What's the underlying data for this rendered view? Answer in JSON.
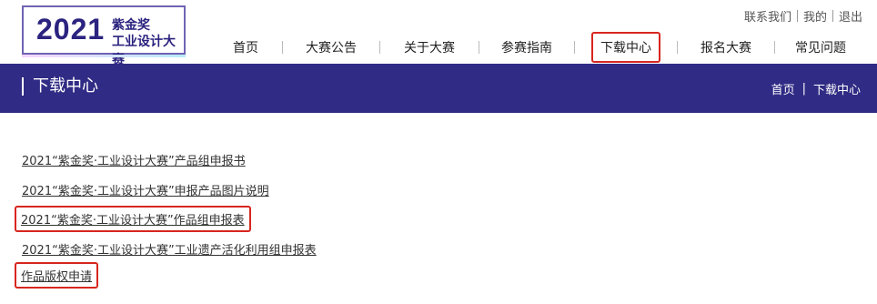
{
  "logo": {
    "year": "2021",
    "line1": "紫金奖",
    "line2": "工业设计大赛"
  },
  "util": {
    "contact": "联系我们",
    "mine": "我的",
    "logout": "退出"
  },
  "nav": {
    "items": [
      "首页",
      "大赛公告",
      "关于大赛",
      "参赛指南",
      "下载中心",
      "报名大赛",
      "常见问题"
    ],
    "active_index": 4,
    "highlight_color": "#d7261f"
  },
  "banner": {
    "title": "下载中心",
    "breadcrumb": [
      "首页",
      "|",
      "下载中心"
    ],
    "background": "#302b84"
  },
  "downloads": [
    "2021“紫金奖·工业设计大赛”产品组申报书",
    "2021“紫金奖·工业设计大赛”申报产品图片说明",
    "2021“紫金奖·工业设计大赛”作品组申报表",
    "2021“紫金奖·工业设计大赛”工业遗产活化利用组申报表",
    "作品版权申请"
  ]
}
